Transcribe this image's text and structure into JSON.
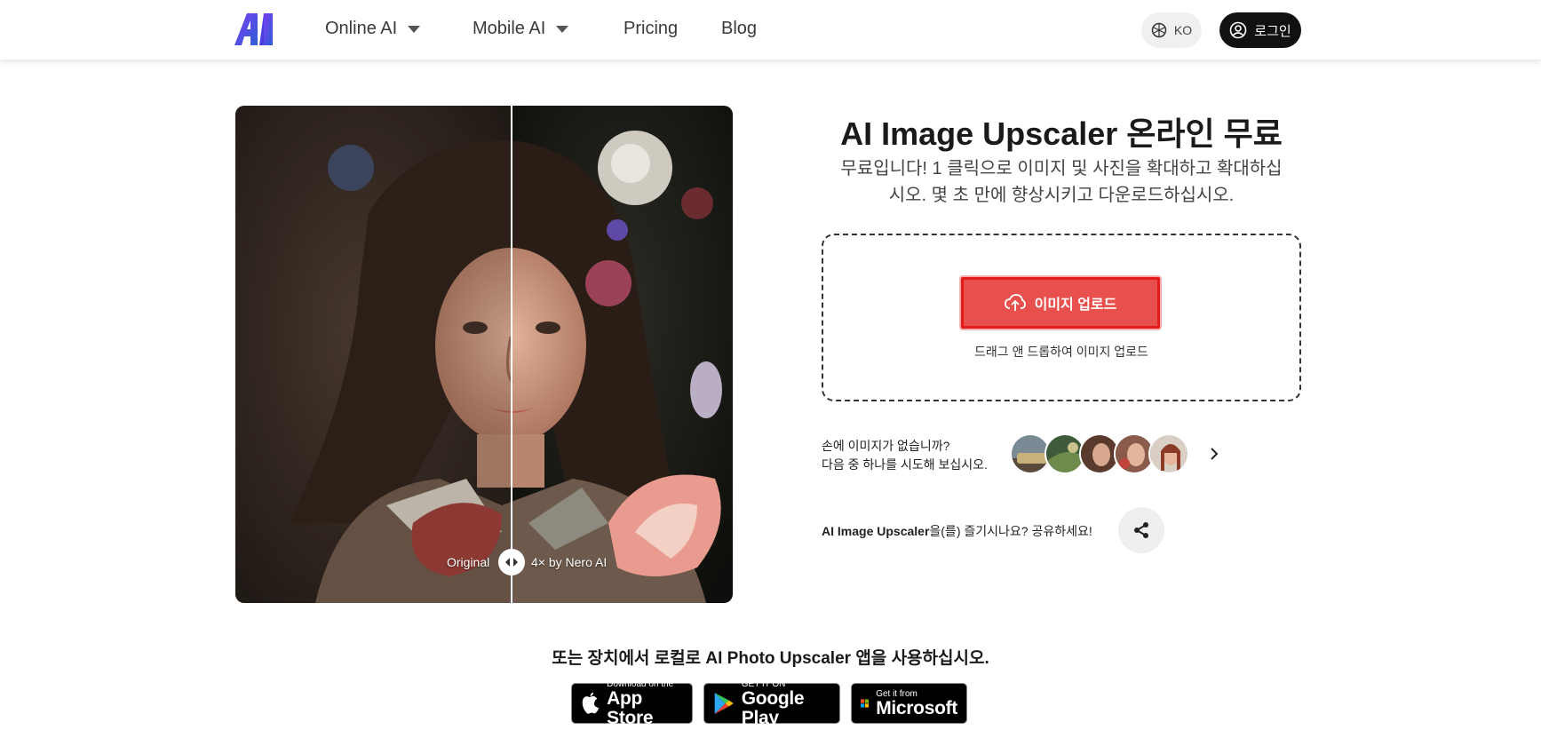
{
  "header": {
    "logo_text": "AI",
    "nav": [
      {
        "label": "Online AI",
        "has_dropdown": true
      },
      {
        "label": "Mobile AI",
        "has_dropdown": true
      },
      {
        "label": "Pricing",
        "has_dropdown": false
      },
      {
        "label": "Blog",
        "has_dropdown": false
      }
    ],
    "language_label": "KO",
    "login_label": "로그인"
  },
  "hero": {
    "original_label": "Original",
    "enhanced_label": "4× by Nero AI"
  },
  "main": {
    "title": "AI Image Upscaler 온라인 무료",
    "subtitle_line1": "무료입니다! 1 클릭으로 이미지 및 사진을 확대하고 확대하십",
    "subtitle_line2": "시오. 몇 초 만에 향상시키고 다운로드하십시오.",
    "upload_button_label": "이미지 업로드",
    "drop_hint_prefix": "드래그 앤 드롭하여 ",
    "drop_hint_link": "이미지 업로드",
    "samples_line1": "손에 이미지가 없습니까?",
    "samples_line2": "다음 중 하나를 시도해 보십시오.",
    "share_bold": "AI Image Upscaler",
    "share_rest": "을(를) 즐기시나요? 공유하세요!"
  },
  "stores": {
    "local_text": "또는 장치에서 로컬로 AI Photo Upscaler 앱을 사용하십시오.",
    "buttons": [
      {
        "small": "Download on the",
        "big": "App Store",
        "icon": "apple-icon"
      },
      {
        "small": "GET IT ON",
        "big": "Google Play",
        "icon": "google-play-icon"
      },
      {
        "small": "Get it from",
        "big": "Microsoft",
        "icon": "microsoft-icon"
      }
    ]
  },
  "colors": {
    "accent_red": "#e8504d",
    "highlight_border": "#e31b1b",
    "logo_gradient_start": "#6b2fe8",
    "logo_gradient_end": "#2a5cd8"
  }
}
